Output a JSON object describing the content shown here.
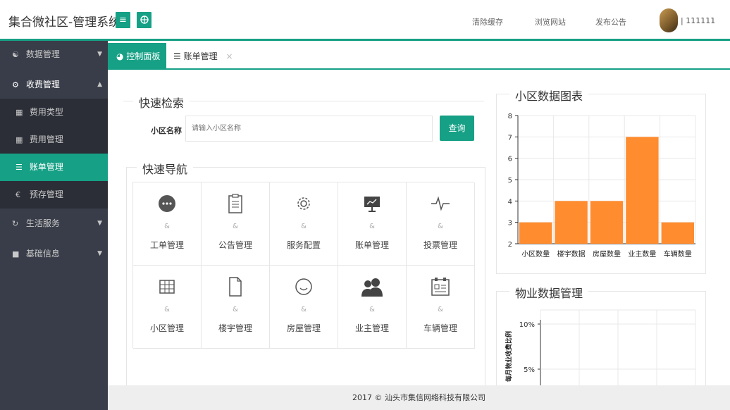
{
  "header": {
    "title": "集合微社区-管理系统",
    "links": [
      "清除缓存",
      "浏览网站",
      "发布公告"
    ],
    "user": "111111"
  },
  "sidebar": {
    "items": [
      {
        "label": "数据管理",
        "icon": "group-icon",
        "level": 0
      },
      {
        "label": "收费管理",
        "icon": "cogs-icon",
        "level": 0
      },
      {
        "label": "费用类型",
        "icon": "table-icon",
        "level": 1
      },
      {
        "label": "费用管理",
        "icon": "table-icon",
        "level": 1
      },
      {
        "label": "账单管理",
        "icon": "list-icon",
        "level": 1
      },
      {
        "label": "预存管理",
        "icon": "coin-icon",
        "level": 1
      },
      {
        "label": "生活服务",
        "icon": "refresh-icon",
        "level": 0
      },
      {
        "label": "基础信息",
        "icon": "book-icon",
        "level": 0
      }
    ]
  },
  "tabs": {
    "home": "控制面板",
    "current": "账单管理",
    "close": "×"
  },
  "search": {
    "legend": "快速检索",
    "label": "小区名称",
    "placeholder": "请输入小区名称",
    "button": "查询"
  },
  "nav": {
    "legend": "快速导航",
    "amp": "&",
    "items": [
      {
        "label": "工单管理",
        "icon": "chat-icon"
      },
      {
        "label": "公告管理",
        "icon": "clipboard-icon"
      },
      {
        "label": "服务配置",
        "icon": "gear-icon"
      },
      {
        "label": "账单管理",
        "icon": "presentation-icon"
      },
      {
        "label": "投票管理",
        "icon": "pulse-icon"
      },
      {
        "label": "小区管理",
        "icon": "table-icon"
      },
      {
        "label": "楼宇管理",
        "icon": "document-icon"
      },
      {
        "label": "房屋管理",
        "icon": "smile-icon"
      },
      {
        "label": "业主管理",
        "icon": "users-icon"
      },
      {
        "label": "车辆管理",
        "icon": "id-card-icon"
      }
    ]
  },
  "chart_panel": {
    "legend": "小区数据图表"
  },
  "chart_data": [
    {
      "type": "bar",
      "title": "",
      "categories": [
        "小区数量",
        "楼宇数据",
        "房屋数量",
        "业主数量",
        "车辆数量"
      ],
      "values": [
        3,
        4,
        4,
        7,
        3
      ],
      "ylim": [
        2,
        8
      ],
      "yticks": [
        2,
        3,
        4,
        5,
        6,
        7,
        8
      ],
      "color": "#ff8c2e",
      "grid": true
    },
    {
      "type": "line",
      "title": "",
      "ylabel": "每月物业收费比例",
      "yticks": [
        "10%",
        "5%"
      ],
      "grid": true
    }
  ],
  "property_panel": {
    "legend": "物业数据管理"
  },
  "footer": {
    "text": "2017 © 汕头市集信网络科技有限公司"
  },
  "colors": {
    "accent": "#16a085",
    "sidebar": "#393d49",
    "bar": "#ff8c2e"
  }
}
